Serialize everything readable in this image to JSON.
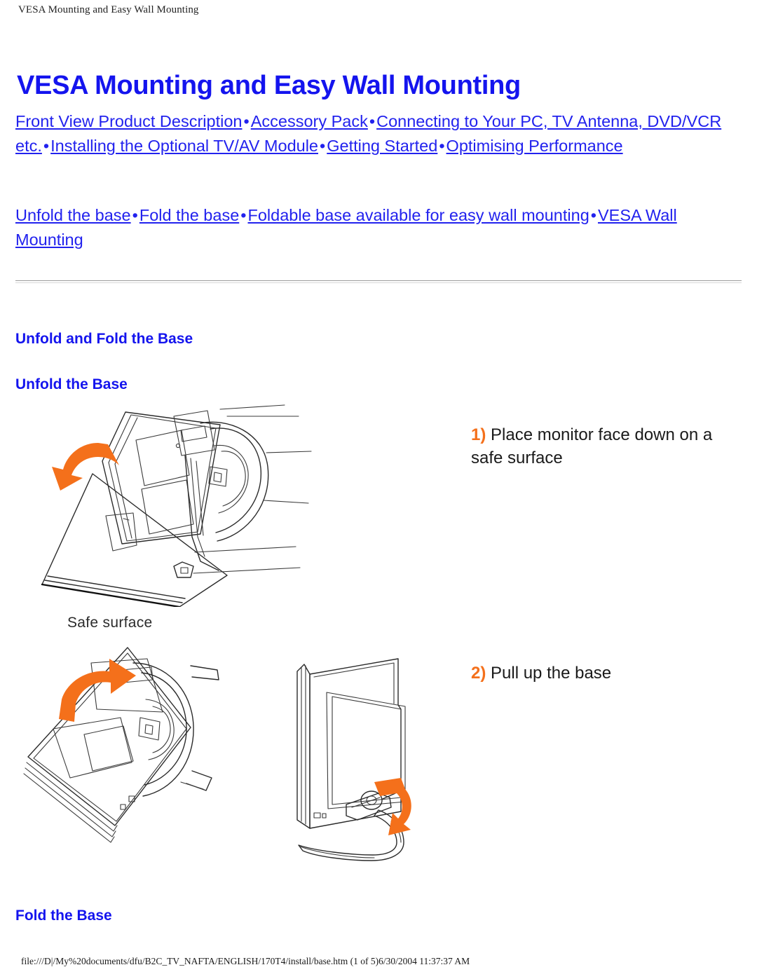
{
  "print_header": "VESA Mounting and Easy Wall Mounting",
  "print_footer": "file:///D|/My%20documents/dfu/B2C_TV_NAFTA/ENGLISH/170T4/install/base.htm (1 of 5)6/30/2004 11:37:37 AM",
  "title": "VESA Mounting and Easy Wall Mounting",
  "colors": {
    "link": "#2222ee",
    "heading": "#1414ee",
    "accent_orange": "#f4701b",
    "body_text": "#1a1a1a",
    "rule": "#9b9b9b"
  },
  "nav_primary": {
    "separator": "•",
    "links": [
      "Front View Product Description",
      "Accessory Pack",
      "Connecting to Your PC, TV Antenna, DVD/VCR etc.",
      "Installing the Optional TV/AV Module",
      "Getting Started",
      "Optimising Performance"
    ]
  },
  "nav_secondary": {
    "separator": "•",
    "links": [
      "Unfold the base",
      "Fold the base",
      "Foldable base available for easy wall mounting",
      "VESA Wall Mounting"
    ]
  },
  "sections": {
    "unfold_and_fold": "Unfold and Fold the Base",
    "unfold_the_base": "Unfold the Base",
    "fold_the_base": "Fold the Base"
  },
  "steps": [
    {
      "number": "1)",
      "text": " Place monitor face down on a safe surface"
    },
    {
      "number": "2)",
      "text": " Pull up the base"
    }
  ],
  "figures": {
    "figure1": {
      "caption": "Safe surface",
      "description": "Monitor placed face down on a safe surface with curved orange rotation arrow"
    },
    "figure2": {
      "description": "Monitor face down, orange arrow showing base being pulled up"
    },
    "figure3": {
      "description": "Monitor standing upright with orange arrow at the base hinge"
    }
  }
}
